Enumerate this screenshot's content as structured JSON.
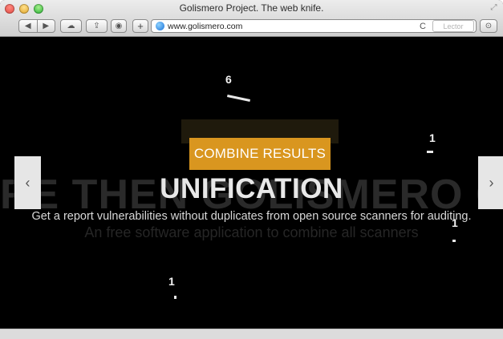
{
  "window": {
    "title": "Golismero Project. The web knife."
  },
  "toolbar": {
    "back_glyph": "◀",
    "forward_glyph": "▶",
    "cloud_glyph": "☁",
    "share_glyph": "⇪",
    "stop_glyph": "◉",
    "plus_glyph": "+",
    "url": "www.golismero.com",
    "reload_glyph": "C",
    "reader_label": "Lector",
    "download_glyph": "⊙"
  },
  "page": {
    "background_text": "RE THEN GOLISMERO G",
    "cta_label": "COMBINE RESULTS",
    "headline": "UNIFICATION",
    "subtitle": "Get a report vulnerabilities without duplicates from open source scanners for auditing.",
    "ghost_subtitle": "An free software application to combine all scanners",
    "prev_glyph": "‹",
    "next_glyph": "›",
    "particles": [
      "6",
      "1",
      "1",
      "1"
    ]
  },
  "colors": {
    "accent": "#d9961f",
    "background": "#000000"
  }
}
